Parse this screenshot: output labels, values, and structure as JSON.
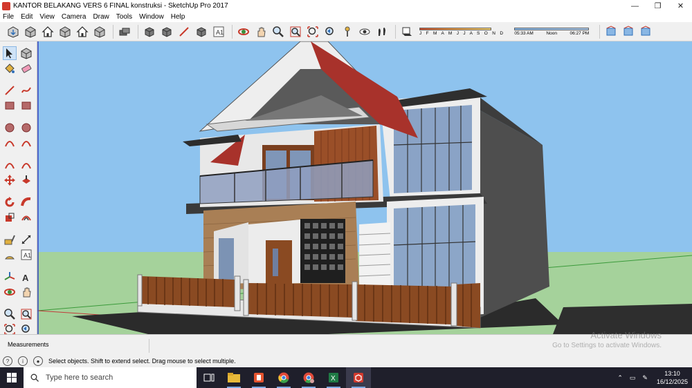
{
  "window": {
    "title": "KANTOR BELAKANG VERS 6 FINAL konstruksi - SketchUp Pro 2017",
    "controls": {
      "minimize": "—",
      "maximize": "❐",
      "close": "✕"
    }
  },
  "menu": [
    "File",
    "Edit",
    "View",
    "Camera",
    "Draw",
    "Tools",
    "Window",
    "Help"
  ],
  "toolbar": {
    "groups": [
      [
        "get-models-icon",
        "components-icon",
        "home-view-icon",
        "warehouse-icon",
        "house-icon",
        "storage-icon"
      ],
      [
        "layers-icon"
      ],
      [
        "xray-style-icon",
        "wireframe-style-icon",
        "hidden-line-style-icon",
        "shaded-style-icon",
        "shaded-texture-style-icon"
      ],
      [
        "orbit-icon",
        "pan-icon",
        "zoom-icon",
        "zoom-window-icon",
        "zoom-extents-icon",
        "previous-view-icon",
        "position-camera-icon",
        "look-around-icon",
        "walk-icon"
      ],
      [
        "shadows-icon"
      ],
      [
        "section-plane-icon",
        "display-section-icon",
        "section-cuts-icon"
      ]
    ],
    "shadow": {
      "months": "J F M A M J J A S O N D",
      "sunrise": "05:33 AM",
      "noon": "Noon",
      "sunset": "06:27 PM"
    }
  },
  "left_tools": [
    "select-icon",
    "make-component-icon",
    "paint-bucket-icon",
    "eraser-icon",
    "line-icon",
    "freehand-icon",
    "rectangle-icon",
    "rotated-rectangle-icon",
    "circle-icon",
    "polygon-icon",
    "arc-icon",
    "two-point-arc-icon",
    "three-point-arc-icon",
    "pie-icon",
    "move-icon",
    "push-pull-icon",
    "rotate-icon",
    "follow-me-icon",
    "scale-icon",
    "offset-icon",
    "tape-measure-icon",
    "dimension-icon",
    "protractor-icon",
    "text-icon",
    "axes-icon",
    "3d-text-icon",
    "orbit-icon",
    "pan-icon",
    "zoom-icon",
    "zoom-window-icon",
    "zoom-extents-icon",
    "previous-icon"
  ],
  "measurements": {
    "label": "Measurements"
  },
  "watermark": {
    "line1": "Activate Windows",
    "line2": "Go to Settings to activate Windows."
  },
  "status": {
    "text": "Select objects. Shift to extend select. Drag mouse to select multiple."
  },
  "taskbar": {
    "search_placeholder": "Type here to search",
    "apps": [
      "task-view-icon",
      "file-explorer-icon",
      "office-icon",
      "chrome-icon",
      "chrome-profile-icon",
      "excel-icon",
      "sketchup-icon"
    ],
    "time": "13:10",
    "date": "16/12/2025"
  },
  "colors": {
    "sky": "#8ec3ee",
    "ground": "#a5d29b",
    "roof_red": "#a8322b",
    "wall_gray": "#5a5a5a",
    "wood": "#9a4f28",
    "stone": "#a97f55"
  }
}
